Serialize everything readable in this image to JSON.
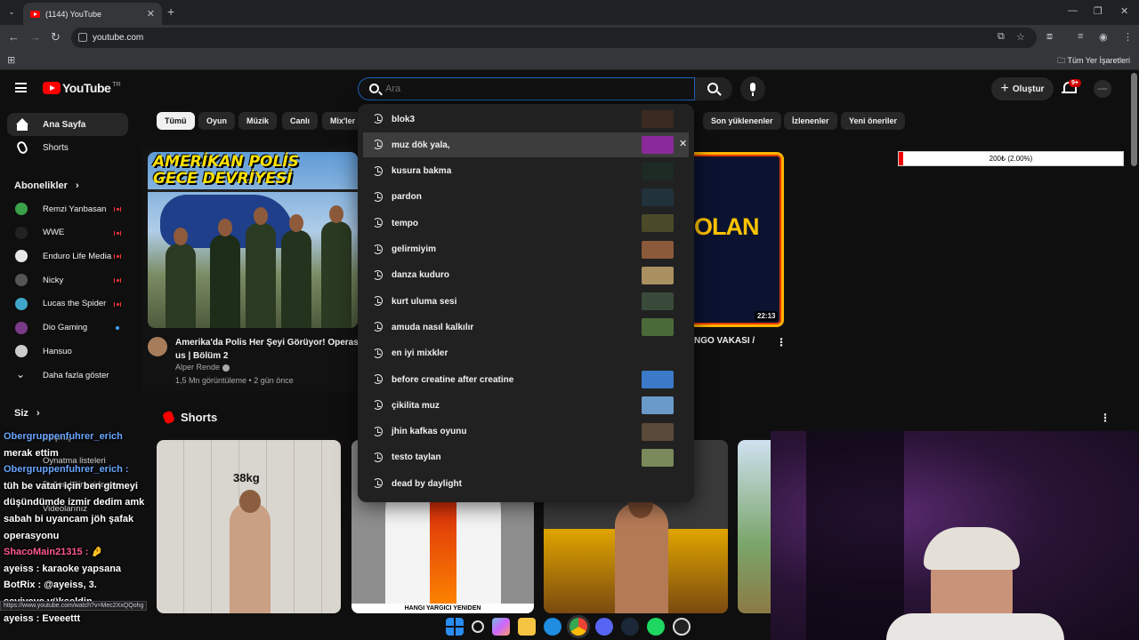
{
  "browser": {
    "tab_title": "(1144) YouTube",
    "url": "youtube.com",
    "all_bookmarks": "Tüm Yer İşaretleri"
  },
  "header": {
    "logo": "YouTube",
    "country": "TR",
    "search_placeholder": "Ara",
    "create_label": "Oluştur",
    "notif_count": "9+"
  },
  "sidebar": {
    "home": "Ana Sayfa",
    "shorts": "Shorts",
    "subscriptions_heading": "Abonelikler",
    "subscriptions": [
      {
        "name": "Remzi Yanbasan",
        "color": "#3aa04a",
        "status": "live"
      },
      {
        "name": "WWE",
        "color": "#222222",
        "status": "live"
      },
      {
        "name": "Enduro Life Media",
        "color": "#e8e8e8",
        "status": "live"
      },
      {
        "name": "Nicky",
        "color": "#555555",
        "status": "live"
      },
      {
        "name": "Lucas the Spider",
        "color": "#3ea6c8",
        "status": "live"
      },
      {
        "name": "Dio Gaming",
        "color": "#7a3a8a",
        "status": "new"
      },
      {
        "name": "Hansuo",
        "color": "#cccccc",
        "status": ""
      }
    ],
    "show_more": "Daha fazla göster",
    "you_heading": "Siz",
    "you_items": [
      "Geçmiş",
      "Oynatma listeleri",
      "Beğendiğim videolar",
      "Videolarınız"
    ]
  },
  "chips": [
    "Tümü",
    "Oyun",
    "Müzik",
    "Canlı",
    "Mix'ler",
    "Son yüklenenler",
    "İzlenenler",
    "Yeni öneriler"
  ],
  "videos": [
    {
      "thumb_text_line1": "AMERİKAN POLİS",
      "thumb_text_line2": "GECE DEVRİYESİ",
      "title": "Amerika'da Polis Her Şeyi Görüyor! Operasyon... us | Bölüm 2",
      "title_line1": "Amerika'da Polis Her Şeyi Görüyor! Operasy",
      "title_line2": "us | Bölüm 2",
      "channel": "Alper Rende",
      "meta": "1,5 Mn görüntüleme • 2 gün önce"
    },
    {
      "thumb_text": "OLAN",
      "duration": "22:13",
      "title_fragment": "NGO VAKASI /"
    }
  ],
  "donation_bar": {
    "text": "200₺ (2.00%)",
    "progress": 0.02
  },
  "shorts_section": {
    "heading": "Shorts",
    "short1_label": "38kg",
    "short2_caption": "HANGI YARGICI YENIDEN"
  },
  "suggestions": [
    {
      "text": "blok3",
      "thumb": "#3a2a22"
    },
    {
      "text": "muz dök yala,",
      "thumb": "#8a2a9a",
      "hover": true
    },
    {
      "text": "kusura bakma",
      "thumb": "#1e2a24"
    },
    {
      "text": "pardon",
      "thumb": "#22323a"
    },
    {
      "text": "tempo",
      "thumb": "#4a4a2a"
    },
    {
      "text": "gelirmiyim",
      "thumb": "#8a5a3a"
    },
    {
      "text": "danza kuduro",
      "thumb": "#a89060"
    },
    {
      "text": "kurt uluma sesi",
      "thumb": "#3a4a3a"
    },
    {
      "text": "amuda nasıl kalkılır",
      "thumb": "#4a6a3a"
    },
    {
      "text": "en iyi mixkler",
      "thumb": ""
    },
    {
      "text": "before creatine after creatine",
      "thumb": "#3a7ac8"
    },
    {
      "text": "çikilita muz",
      "thumb": "#6a9ac8"
    },
    {
      "text": "jhin kafkas oyunu",
      "thumb": "#5a4a3a"
    },
    {
      "text": "testo taylan",
      "thumb": "#7a8a5a"
    },
    {
      "text": "dead by daylight",
      "thumb": ""
    }
  ],
  "chat": {
    "lines": [
      {
        "name": "Obergruppenfuhrer_erich",
        "name_color": "blue",
        "text": ""
      },
      {
        "name": "",
        "text": "merak ettim"
      },
      {
        "name": "Obergruppenfuhrer_erich :",
        "name_color": "blue",
        "text": ""
      },
      {
        "name": "",
        "text": "tüh be vatan için ben gitmeyi"
      },
      {
        "name": "",
        "text": "düşündümde izmir dedim amk"
      },
      {
        "name": "",
        "text": "sabah bi uyancam jöh şafak"
      },
      {
        "name": "",
        "text": "operasyonu"
      },
      {
        "name": "ShacoMain21315 :",
        "name_color": "pink",
        "text": "🤌"
      },
      {
        "name": "ayeiss",
        "text": ": karaoke yapsana"
      },
      {
        "name": "BotRix",
        "text": ": @ayeiss, 3."
      },
      {
        "name": "",
        "text": "seviyeye yükseldin"
      },
      {
        "name": "ayeiss",
        "text": ": Eveeettt"
      }
    ],
    "url_tooltip": "https://www.youtube.com/watch?v=Mec2XxQQohg"
  }
}
